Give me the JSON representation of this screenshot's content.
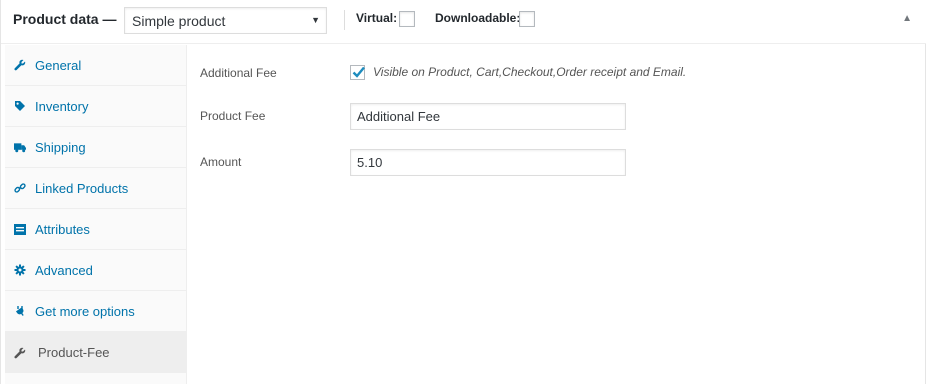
{
  "header": {
    "title": "Product data —",
    "product_type": {
      "selected": "Simple product"
    },
    "virtual_label": "Virtual:",
    "downloadable_label": "Downloadable:"
  },
  "sidebar": {
    "items": [
      {
        "label": "General",
        "icon": "wrench-icon"
      },
      {
        "label": "Inventory",
        "icon": "tag-icon"
      },
      {
        "label": "Shipping",
        "icon": "truck-icon"
      },
      {
        "label": "Linked Products",
        "icon": "link-icon"
      },
      {
        "label": "Attributes",
        "icon": "list-icon"
      },
      {
        "label": "Advanced",
        "icon": "gear-icon"
      },
      {
        "label": "Get more options",
        "icon": "plugin-icon"
      },
      {
        "label": "Product-Fee",
        "icon": "wrench-icon",
        "active": true
      }
    ]
  },
  "main": {
    "additional_fee": {
      "label": "Additional Fee",
      "checked": true,
      "description": "Visible on Product, Cart,Checkout,Order receipt and Email."
    },
    "product_fee": {
      "label": "Product Fee",
      "value": "Additional Fee"
    },
    "amount": {
      "label": "Amount",
      "value": "5.10"
    }
  },
  "colors": {
    "link": "#0073aa",
    "active_tab_bg": "#eeeeee",
    "sidebar_bg": "#fafafa",
    "checkmark": "#1e8cbe"
  }
}
